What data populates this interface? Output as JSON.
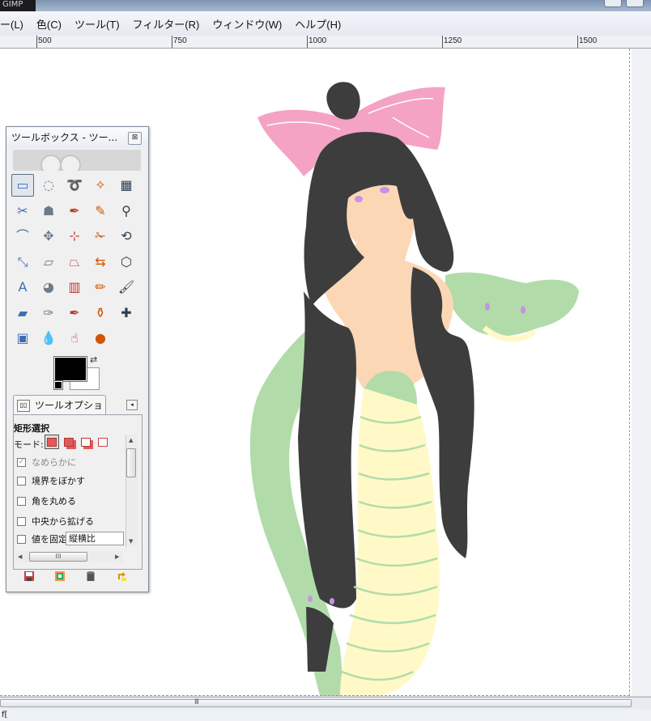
{
  "window": {
    "app_name": "GIMP"
  },
  "menubar": {
    "items": [
      {
        "label": "ー(L)"
      },
      {
        "label": "色(C)"
      },
      {
        "label": "ツール(T)"
      },
      {
        "label": "フィルター(R)"
      },
      {
        "label": "ウィンドウ(W)"
      },
      {
        "label": "ヘルプ(H)"
      }
    ]
  },
  "ruler": {
    "labels": [
      "500",
      "750",
      "1000",
      "1250",
      "1500"
    ]
  },
  "toolbox": {
    "title": "ツールボックス - ツー...",
    "close_glyph": "⊠",
    "tools": [
      {
        "name": "rect-select-icon",
        "glyph": "▭"
      },
      {
        "name": "ellipse-select-icon",
        "glyph": "◌"
      },
      {
        "name": "lasso-icon",
        "glyph": "➰"
      },
      {
        "name": "fuzzy-select-icon",
        "glyph": "✧"
      },
      {
        "name": "color-select-icon",
        "glyph": "▦"
      },
      {
        "name": "scissors-icon",
        "glyph": "✂"
      },
      {
        "name": "foreground-select-icon",
        "glyph": "☗"
      },
      {
        "name": "paths-icon",
        "glyph": "✒"
      },
      {
        "name": "color-picker-icon",
        "glyph": "✎"
      },
      {
        "name": "zoom-icon",
        "glyph": "⚲"
      },
      {
        "name": "measure-icon",
        "glyph": "⌒"
      },
      {
        "name": "move-icon",
        "glyph": "✥"
      },
      {
        "name": "align-icon",
        "glyph": "⊹"
      },
      {
        "name": "crop-icon",
        "glyph": "✁"
      },
      {
        "name": "rotate-icon",
        "glyph": "⟲"
      },
      {
        "name": "scale-icon",
        "glyph": "⤡"
      },
      {
        "name": "shear-icon",
        "glyph": "▱"
      },
      {
        "name": "perspective-icon",
        "glyph": "⏢"
      },
      {
        "name": "flip-icon",
        "glyph": "⇆"
      },
      {
        "name": "cage-icon",
        "glyph": "⬡"
      },
      {
        "name": "text-icon",
        "glyph": "A"
      },
      {
        "name": "bucket-fill-icon",
        "glyph": "◕"
      },
      {
        "name": "blend-icon",
        "glyph": "▥"
      },
      {
        "name": "pencil-icon",
        "glyph": "✏"
      },
      {
        "name": "paintbrush-icon",
        "glyph": "🖌"
      },
      {
        "name": "eraser-icon",
        "glyph": "▰"
      },
      {
        "name": "airbrush-icon",
        "glyph": "✑"
      },
      {
        "name": "ink-icon",
        "glyph": "✒"
      },
      {
        "name": "clone-icon",
        "glyph": "⚱"
      },
      {
        "name": "heal-icon",
        "glyph": "✚"
      },
      {
        "name": "perspective-clone-icon",
        "glyph": "▣"
      },
      {
        "name": "blur-icon",
        "glyph": "💧"
      },
      {
        "name": "smudge-icon",
        "glyph": "☝"
      },
      {
        "name": "dodge-burn-icon",
        "glyph": "●"
      }
    ],
    "foreground_color": "#000000",
    "background_color": "#ffffff"
  },
  "tool_options": {
    "tab_label": "ツールオプション",
    "heading": "矩形選択",
    "mode_label": "モード:",
    "options": [
      {
        "label": "なめらかに",
        "checked": true,
        "disabled": true
      },
      {
        "label": "境界をぼかす",
        "checked": false,
        "disabled": false
      },
      {
        "label": "角を丸める",
        "checked": false,
        "disabled": false
      },
      {
        "label": "中央から拡げる",
        "checked": false,
        "disabled": false
      },
      {
        "label": "値を固定",
        "checked": false,
        "disabled": false
      }
    ],
    "fixed_combo_value": "縦横比",
    "hscroll_grip": "III"
  },
  "status": {
    "text": "f["
  },
  "canvas": {
    "colors": {
      "hair": "#3d3d3d",
      "skin": "#fcd7b6",
      "snake_green": "#b1dcaa",
      "belly_yellow": "#fef9c7",
      "bow_pink": "#f4a3c4",
      "eye_purple": "#c892e4"
    }
  }
}
